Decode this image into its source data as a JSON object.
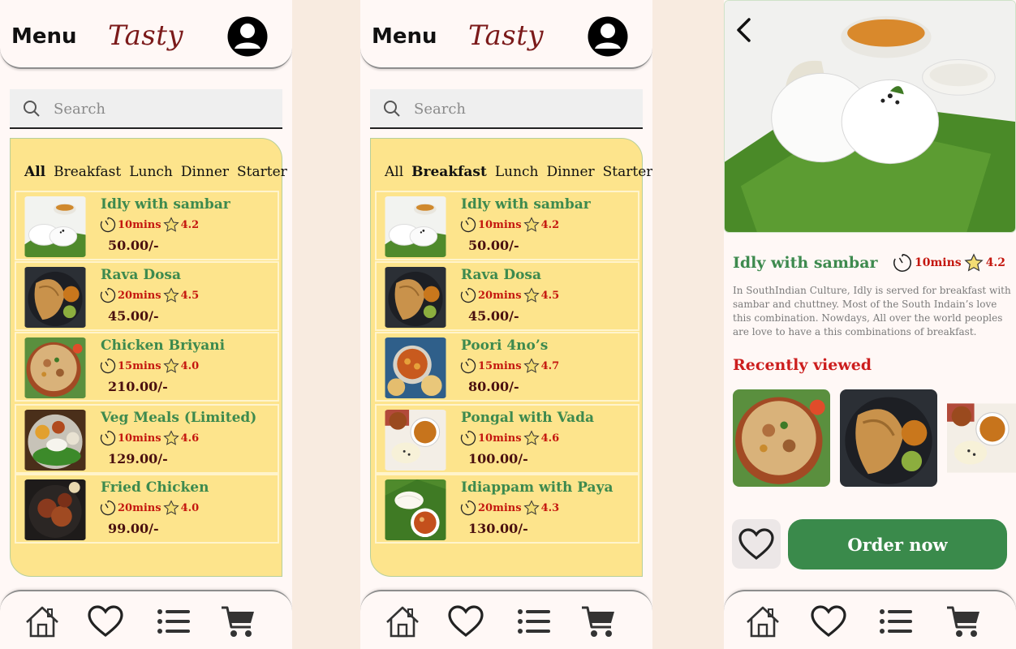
{
  "app": {
    "menu_label": "Menu",
    "brand": "Tasty"
  },
  "search": {
    "placeholder": "Search"
  },
  "tabs": [
    "All",
    "Breakfast",
    "Lunch",
    "Dinner",
    "Starter"
  ],
  "screen1": {
    "active_tab": "All",
    "items": [
      {
        "name": "Idly with sambar",
        "time": "10mins",
        "rating": "4.2",
        "price": "50.00/-"
      },
      {
        "name": "Rava Dosa",
        "time": "20mins",
        "rating": "4.5",
        "price": "45.00/-"
      },
      {
        "name": "Chicken Briyani",
        "time": "15mins",
        "rating": "4.0",
        "price": "210.00/-"
      },
      {
        "name": "Veg Meals (Limited)",
        "time": "10mins",
        "rating": "4.6",
        "price": "129.00/-"
      },
      {
        "name": "Fried Chicken",
        "time": "20mins",
        "rating": "4.0",
        "price": "99.00/-"
      }
    ]
  },
  "screen2": {
    "active_tab": "Breakfast",
    "items": [
      {
        "name": "Idly with sambar",
        "time": "10mins",
        "rating": "4.2",
        "price": "50.00/-"
      },
      {
        "name": "Rava Dosa",
        "time": "20mins",
        "rating": "4.5",
        "price": "45.00/-"
      },
      {
        "name": "Poori 4no’s",
        "time": "15mins",
        "rating": "4.7",
        "price": "80.00/-"
      },
      {
        "name": "Pongal with Vada",
        "time": "10mins",
        "rating": "4.6",
        "price": "100.00/-"
      },
      {
        "name": "Idiappam with Paya",
        "time": "20mins",
        "rating": "4.3",
        "price": "130.00/-"
      }
    ]
  },
  "detail": {
    "title": "Idly with sambar",
    "time": "10mins",
    "rating": "4.2",
    "description": "In SouthIndian Culture, Idly is served for breakfast with sambar and chuttney. Most of the South Indain’s love this combination. Nowdays, All over the world peoples are love to have a this combinations of breakfast.",
    "recently_viewed_label": "Recently viewed",
    "order_label": "Order now"
  },
  "colors": {
    "panel": "#fde48c",
    "accent_green": "#3a8a4b",
    "price": "#4a1010",
    "meta_red": "#c4170f",
    "brand": "#7b1a1a"
  },
  "icons": [
    "avatar-icon",
    "search-icon",
    "clock-icon",
    "star-icon",
    "home-icon",
    "heart-icon",
    "list-icon",
    "cart-icon",
    "back-arrow-icon"
  ]
}
